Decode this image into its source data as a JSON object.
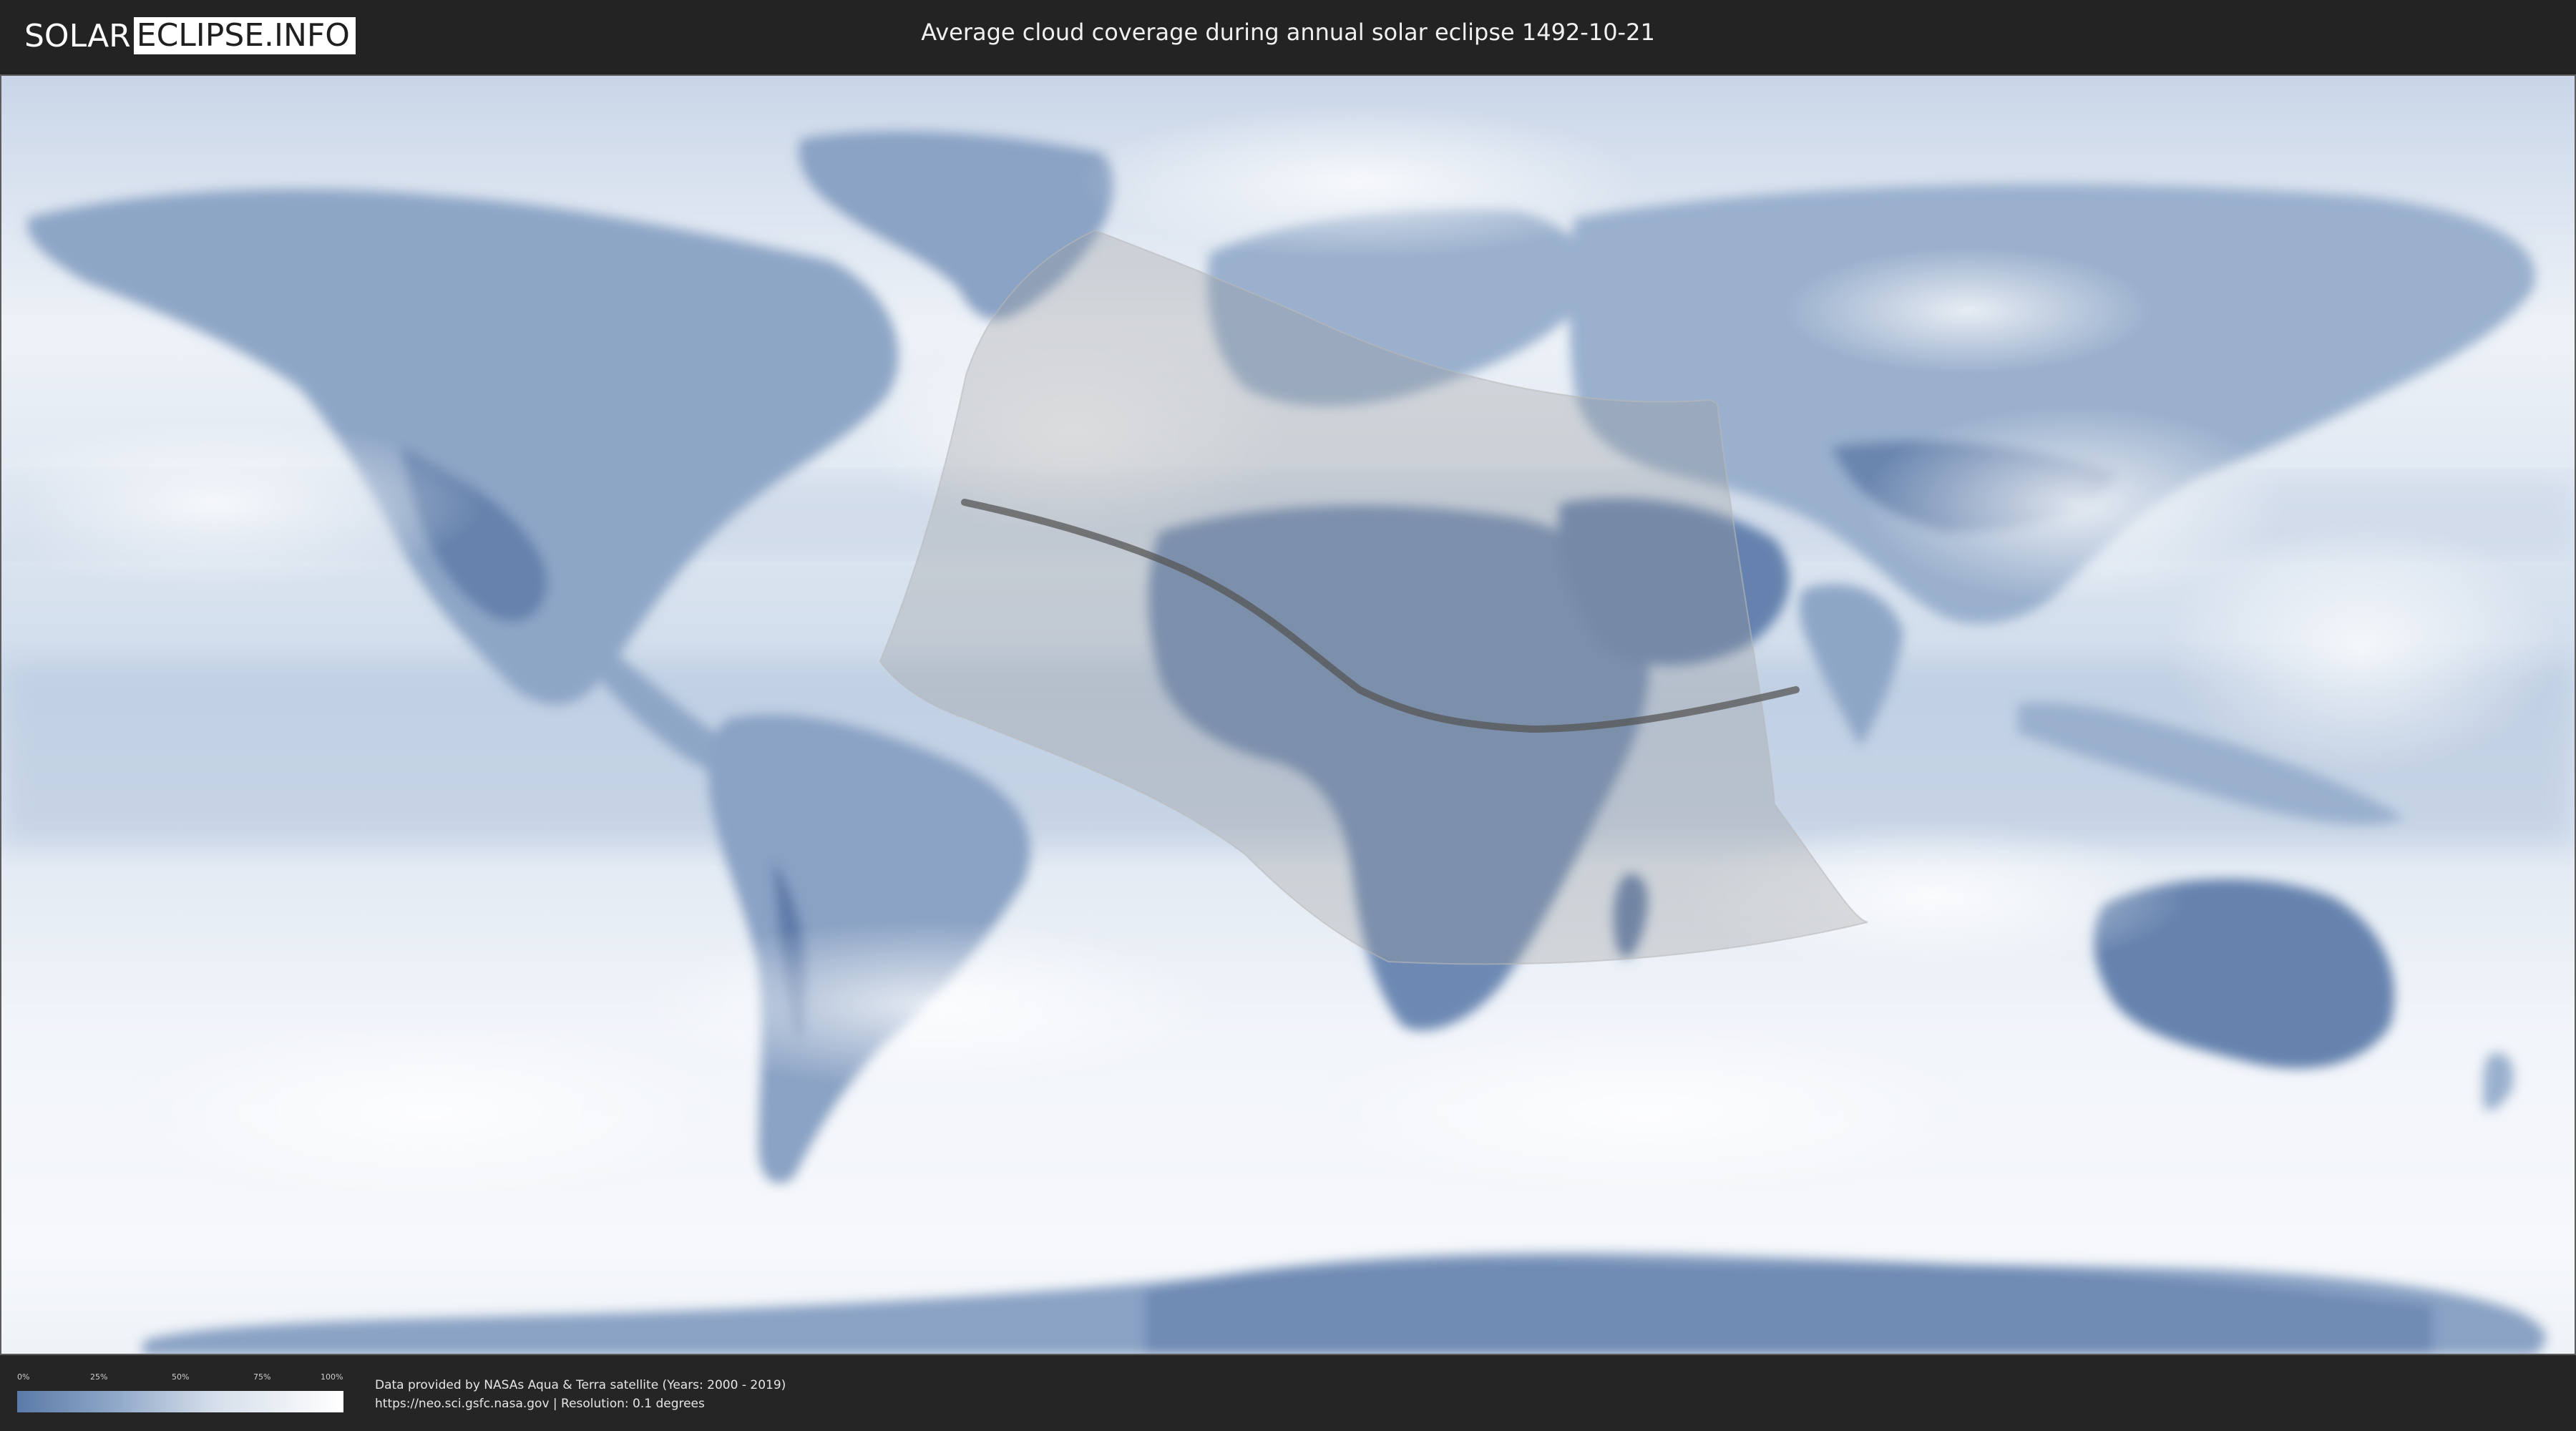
{
  "header": {
    "logo_left": "SOLAR",
    "logo_right": "ECLIPSE.INFO",
    "title": "Average cloud coverage during annual solar eclipse 1492-10-21"
  },
  "legend": {
    "labels": [
      "0%",
      "25%",
      "50%",
      "75%",
      "100%"
    ],
    "gradient_colors": [
      "#5b7aa8",
      "#8fa8c8",
      "#d5deea",
      "#ffffff"
    ]
  },
  "footer": {
    "line1": "Data provided by NASAs Aqua & Terra satellite (Years: 2000 - 2019)",
    "line2": "https://neo.sci.gsfc.nasa.gov | Resolution: 0.1 degrees"
  },
  "map": {
    "ocean_color": "#e4ebf4",
    "land_color": "#7f98bd",
    "cloud_color": "#ffffff",
    "eclipse_zone_color": "#9a9a9a",
    "central_line_color": "#555555",
    "icons": [
      "world-map",
      "eclipse-visibility-zone",
      "central-line"
    ]
  }
}
